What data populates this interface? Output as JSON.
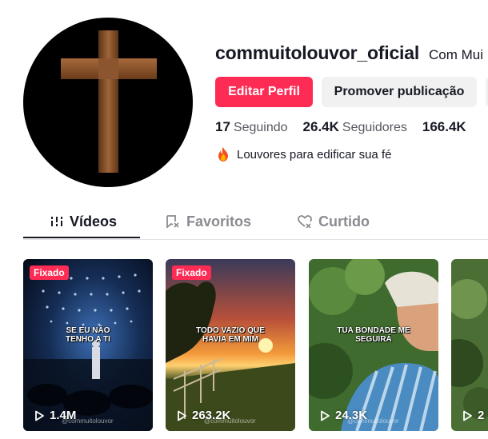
{
  "profile": {
    "username": "commuitolouvor_oficial",
    "display_name": "Com Mui",
    "avatar_icon": "cross-icon",
    "bio": "Louvores para edificar sua fé",
    "bio_icon": "fire-emoji-icon"
  },
  "actions": {
    "edit_label": "Editar Perfil",
    "promote_label": "Promover publicação"
  },
  "stats": {
    "following_count": "17",
    "following_label": "Seguindo",
    "followers_count": "26.4K",
    "followers_label": "Seguidores",
    "likes_count": "166.4K"
  },
  "tabs": [
    {
      "label": "Vídeos",
      "icon": "grid-bars-icon",
      "active": true
    },
    {
      "label": "Favoritos",
      "icon": "bookmark-icon",
      "active": false
    },
    {
      "label": "Curtido",
      "icon": "heart-icon",
      "active": false
    }
  ],
  "videos": [
    {
      "pinned_label": "Fixado",
      "caption": "SE EU NÃO\nTENHO A TI",
      "views": "1.4M",
      "watermark": "@commuitolouvor"
    },
    {
      "pinned_label": "Fixado",
      "caption": "TODO VAZIO QUE\nHAVIA EM MIM",
      "views": "263.2K",
      "watermark": "@commuitolouvor"
    },
    {
      "pinned_label": "",
      "caption": "TUA BONDADE ME\nSEGUIRÁ",
      "views": "24.3K",
      "watermark": "@commuitolouvor"
    },
    {
      "pinned_label": "",
      "caption": "",
      "views": "2",
      "watermark": ""
    }
  ],
  "colors": {
    "accent": "#fe2c55",
    "text": "#161823",
    "secondary_text": "#57585f",
    "button_gray": "#f1f1f2"
  }
}
